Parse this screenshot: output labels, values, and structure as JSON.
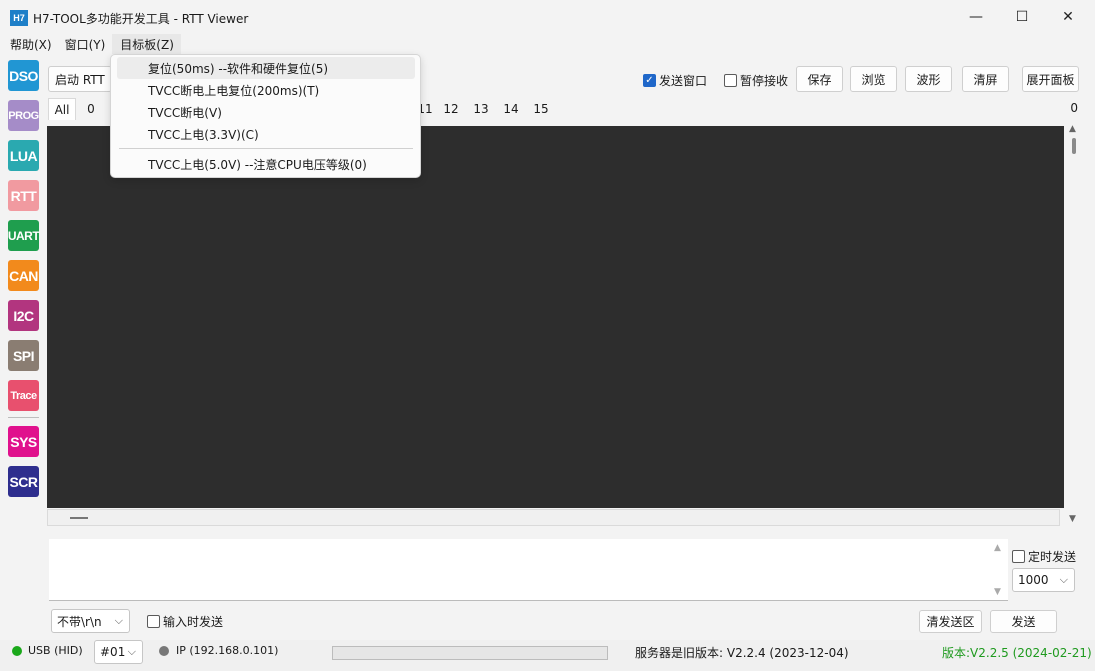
{
  "window": {
    "app_icon_text": "H7",
    "title": "H7-TOOL多功能开发工具 - RTT Viewer",
    "minimize_glyph": "—",
    "maximize_glyph": "☐",
    "close_glyph": "✕"
  },
  "menubar": {
    "items": [
      "帮助(X)",
      "窗口(Y)",
      "目标板(Z)"
    ]
  },
  "dropdown": {
    "items": [
      "复位(50ms)  --软件和硬件复位(5)",
      "TVCC断电上电复位(200ms)(T)",
      "TVCC断电(V)",
      "TVCC上电(3.3V)(C)",
      "TVCC上电(5.0V) --注意CPU电压等级(0)"
    ]
  },
  "sidebar": {
    "buttons": [
      {
        "label": "DSO",
        "color": "#2196d3"
      },
      {
        "label": "PROG",
        "color": "#a58cc8"
      },
      {
        "label": "LUA",
        "color": "#2aa9b0"
      },
      {
        "label": "RTT",
        "color": "#f19aa0"
      },
      {
        "label": "UART",
        "color": "#1f9e4e"
      },
      {
        "label": "CAN",
        "color": "#f28a1c"
      },
      {
        "label": "I2C",
        "color": "#b2357f"
      },
      {
        "label": "SPI",
        "color": "#8a7d72"
      },
      {
        "label": "Trace",
        "color": "#e8506e"
      },
      {
        "label": "SYS",
        "color": "#e0118d"
      },
      {
        "label": "SCR",
        "color": "#2e2e8e"
      }
    ]
  },
  "toolbar": {
    "start_rtt": "启动 RTT",
    "send_window_label": "发送窗口",
    "send_window_checked": true,
    "pause_recv_label": "暂停接收",
    "pause_recv_checked": false,
    "save": "保存",
    "browse": "浏览",
    "waveform": "波形",
    "clear": "清屏",
    "expand_panel": "展开面板"
  },
  "tabs": {
    "all": "All",
    "visible": [
      "0",
      "11",
      "12",
      "13",
      "14",
      "15"
    ]
  },
  "counter": "0",
  "send_panel": {
    "timed_send_label": "定时发送",
    "timed_send_checked": false,
    "interval_value": "1000",
    "line_ending_value": "不带\\r\\n",
    "send_on_input_label": "输入时发送",
    "send_on_input_checked": false,
    "clear_send_area": "清发送区",
    "send": "发送"
  },
  "status": {
    "usb_label": "USB (HID)",
    "usb_dot_color": "#1aa81a",
    "device_select": "#01",
    "ip_label": "IP (192.168.0.101)",
    "ip_dot_color": "#777777",
    "server_version": "服务器是旧版本: V2.2.4 (2023-12-04)",
    "local_version": "版本:V2.2.5 (2024-02-21)",
    "local_version_color": "#1f9a1f"
  }
}
